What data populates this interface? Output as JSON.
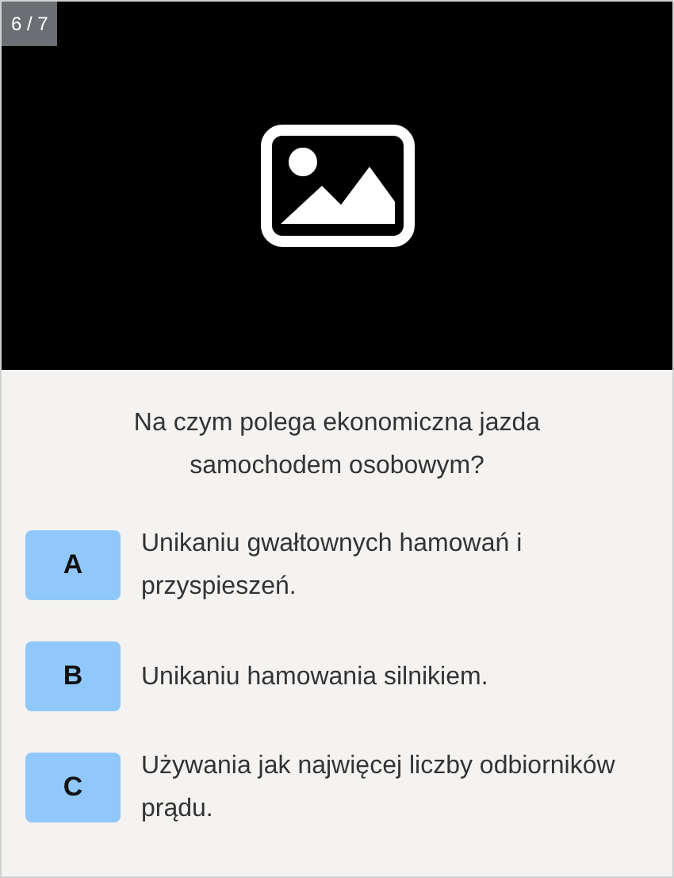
{
  "counter": "6 / 7",
  "question": "Na czym polega ekonomiczna jazda samochodem osobowym?",
  "answers": [
    {
      "letter": "A",
      "text": "Unikaniu gwałtownych hamowań i przyspieszeń."
    },
    {
      "letter": "B",
      "text": "Unikaniu hamowania silnikiem."
    },
    {
      "letter": "C",
      "text": "Używania jak najwięcej liczby odbiorników prądu."
    }
  ]
}
